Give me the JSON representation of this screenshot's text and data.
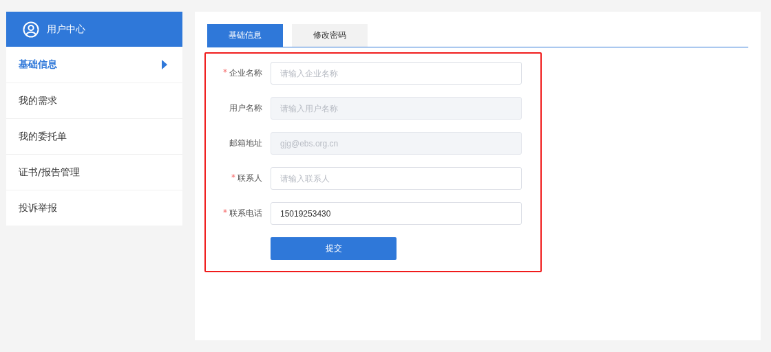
{
  "sidebar": {
    "title": "用户中心",
    "items": [
      {
        "label": "基础信息",
        "selected": true
      },
      {
        "label": "我的需求",
        "selected": false
      },
      {
        "label": "我的委托单",
        "selected": false
      },
      {
        "label": "证书/报告管理",
        "selected": false
      },
      {
        "label": "投诉举报",
        "selected": false
      }
    ]
  },
  "tabs": [
    {
      "label": "基础信息",
      "selected": true
    },
    {
      "label": "修改密码",
      "selected": false
    }
  ],
  "form": {
    "fields": [
      {
        "label": "企业名称",
        "required_mark": "*",
        "disabled": false,
        "placeholder": "请输入企业名称"
      },
      {
        "label": "用户名称",
        "disabled": true,
        "placeholder": "请输入用户名称"
      },
      {
        "label": "邮箱地址",
        "disabled": true,
        "value": "gjg@ebs.org.cn"
      },
      {
        "label": "联系人",
        "required_mark": "*",
        "disabled": false,
        "placeholder": "请输入联系人"
      },
      {
        "label": "联系电话",
        "required_mark": "*",
        "disabled": false,
        "value": "15019253430"
      }
    ],
    "submit": "提交"
  }
}
